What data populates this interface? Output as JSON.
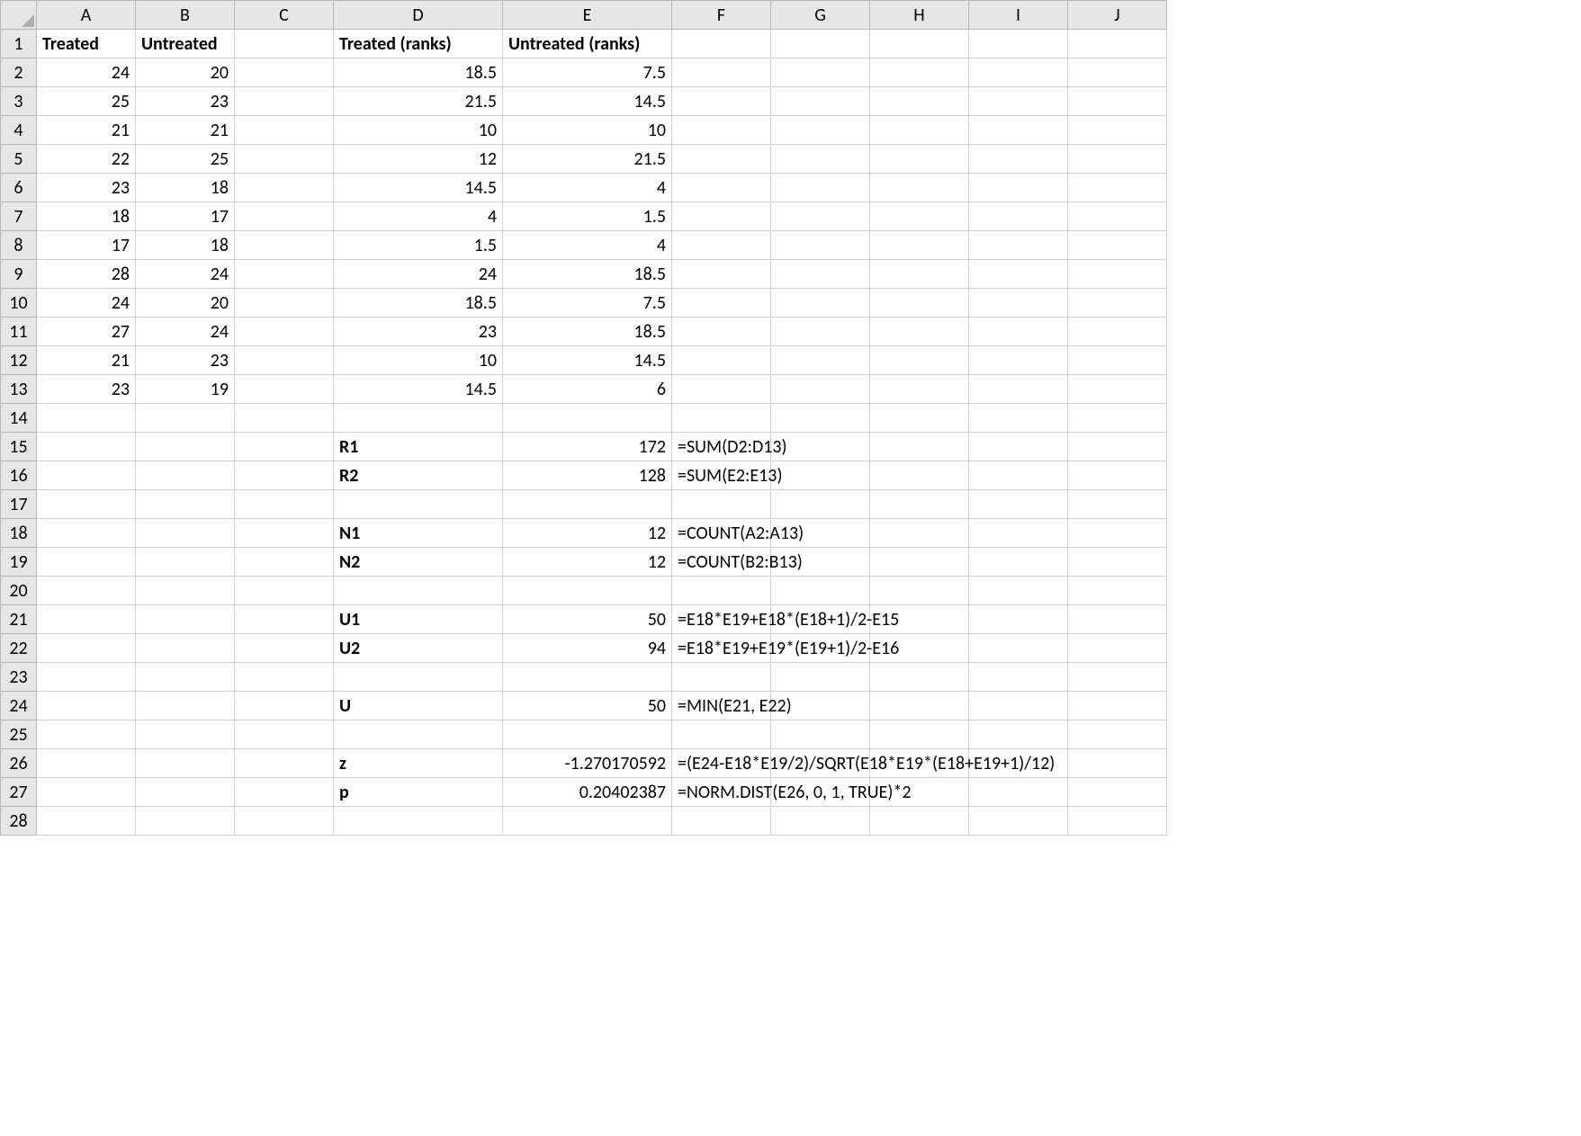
{
  "columns": [
    "A",
    "B",
    "C",
    "D",
    "E",
    "F",
    "G",
    "H",
    "I",
    "J"
  ],
  "rowCount": 28,
  "headers": {
    "A1": "Treated",
    "B1": "Untreated",
    "D1": "Treated (ranks)",
    "E1": "Untreated (ranks)"
  },
  "data_rows": [
    {
      "A": "24",
      "B": "20",
      "D": "18.5",
      "E": "7.5"
    },
    {
      "A": "25",
      "B": "23",
      "D": "21.5",
      "E": "14.5"
    },
    {
      "A": "21",
      "B": "21",
      "D": "10",
      "E": "10"
    },
    {
      "A": "22",
      "B": "25",
      "D": "12",
      "E": "21.5"
    },
    {
      "A": "23",
      "B": "18",
      "D": "14.5",
      "E": "4"
    },
    {
      "A": "18",
      "B": "17",
      "D": "4",
      "E": "1.5"
    },
    {
      "A": "17",
      "B": "18",
      "D": "1.5",
      "E": "4"
    },
    {
      "A": "28",
      "B": "24",
      "D": "24",
      "E": "18.5"
    },
    {
      "A": "24",
      "B": "20",
      "D": "18.5",
      "E": "7.5"
    },
    {
      "A": "27",
      "B": "24",
      "D": "23",
      "E": "18.5"
    },
    {
      "A": "21",
      "B": "23",
      "D": "10",
      "E": "14.5"
    },
    {
      "A": "23",
      "B": "19",
      "D": "14.5",
      "E": "6"
    }
  ],
  "summary": [
    {
      "row": 15,
      "label": "R1",
      "value": "172",
      "formula": "=SUM(D2:D13)"
    },
    {
      "row": 16,
      "label": "R2",
      "value": "128",
      "formula": "=SUM(E2:E13)"
    },
    {
      "row": 18,
      "label": "N1",
      "value": "12",
      "formula": "=COUNT(A2:A13)"
    },
    {
      "row": 19,
      "label": "N2",
      "value": "12",
      "formula": "=COUNT(B2:B13)"
    },
    {
      "row": 21,
      "label": "U1",
      "value": "50",
      "formula": "=E18*E19+E18*(E18+1)/2-E15"
    },
    {
      "row": 22,
      "label": "U2",
      "value": "94",
      "formula": "=E18*E19+E19*(E19+1)/2-E16"
    },
    {
      "row": 24,
      "label": "U",
      "value": "50",
      "formula": "=MIN(E21, E22)"
    },
    {
      "row": 26,
      "label": "z",
      "value": "-1.270170592",
      "formula": "=(E24-E18*E19/2)/SQRT(E18*E19*(E18+E19+1)/12)"
    },
    {
      "row": 27,
      "label": "p",
      "value": "0.20402387",
      "formula": "=NORM.DIST(E26, 0, 1, TRUE)*2"
    }
  ],
  "chart_data": {
    "type": "table",
    "title": "Mann-Whitney U test worksheet",
    "series": [
      {
        "name": "Treated",
        "values": [
          24,
          25,
          21,
          22,
          23,
          18,
          17,
          28,
          24,
          27,
          21,
          23
        ]
      },
      {
        "name": "Untreated",
        "values": [
          20,
          23,
          21,
          25,
          18,
          17,
          18,
          24,
          20,
          24,
          23,
          19
        ]
      },
      {
        "name": "Treated (ranks)",
        "values": [
          18.5,
          21.5,
          10,
          12,
          14.5,
          4,
          1.5,
          24,
          18.5,
          23,
          10,
          14.5
        ]
      },
      {
        "name": "Untreated (ranks)",
        "values": [
          7.5,
          14.5,
          10,
          21.5,
          4,
          1.5,
          4,
          18.5,
          7.5,
          18.5,
          14.5,
          6
        ]
      }
    ],
    "stats": {
      "R1": 172,
      "R2": 128,
      "N1": 12,
      "N2": 12,
      "U1": 50,
      "U2": 94,
      "U": 50,
      "z": -1.270170592,
      "p": 0.20402387
    }
  }
}
